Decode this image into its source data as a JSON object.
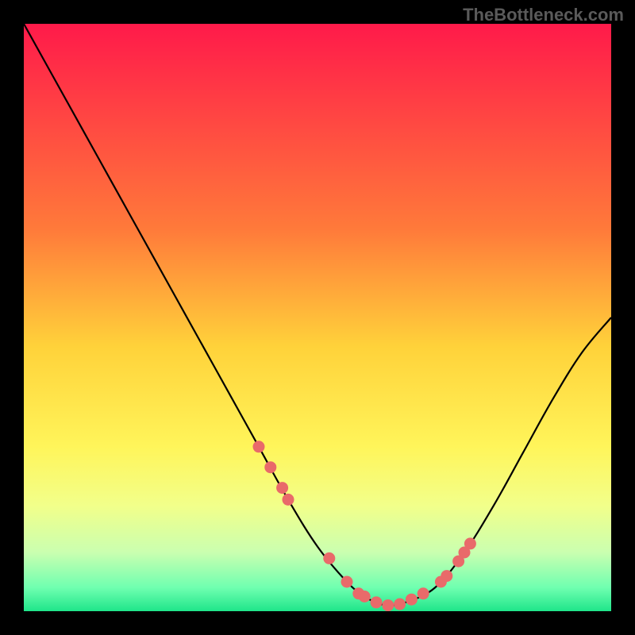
{
  "watermark": "TheBottleneck.com",
  "chart_data": {
    "type": "line",
    "title": "",
    "xlabel": "",
    "ylabel": "",
    "xlim": [
      0,
      100
    ],
    "ylim": [
      0,
      100
    ],
    "gradient_stops": [
      {
        "offset": 0,
        "color": "#ff1a4a"
      },
      {
        "offset": 35,
        "color": "#ff7a3a"
      },
      {
        "offset": 55,
        "color": "#ffd23a"
      },
      {
        "offset": 72,
        "color": "#fff55a"
      },
      {
        "offset": 82,
        "color": "#f2ff8a"
      },
      {
        "offset": 90,
        "color": "#caffb0"
      },
      {
        "offset": 96,
        "color": "#6fffb0"
      },
      {
        "offset": 100,
        "color": "#1fe58a"
      }
    ],
    "series": [
      {
        "name": "bottleneck-curve",
        "x": [
          0,
          5,
          10,
          15,
          20,
          25,
          30,
          35,
          40,
          45,
          50,
          55,
          58,
          60,
          62,
          65,
          70,
          75,
          80,
          85,
          90,
          95,
          100
        ],
        "y": [
          100,
          91,
          82,
          73,
          64,
          55,
          46,
          37,
          28,
          19,
          11,
          5,
          2.5,
          1.5,
          1,
          1.5,
          4,
          10,
          18,
          27,
          36,
          44,
          50
        ]
      }
    ],
    "markers": {
      "name": "highlight-points",
      "color": "#e96a6a",
      "points": [
        {
          "x": 40,
          "y": 28
        },
        {
          "x": 42,
          "y": 24.5
        },
        {
          "x": 44,
          "y": 21
        },
        {
          "x": 45,
          "y": 19
        },
        {
          "x": 52,
          "y": 9
        },
        {
          "x": 55,
          "y": 5
        },
        {
          "x": 57,
          "y": 3
        },
        {
          "x": 58,
          "y": 2.5
        },
        {
          "x": 60,
          "y": 1.5
        },
        {
          "x": 62,
          "y": 1
        },
        {
          "x": 64,
          "y": 1.2
        },
        {
          "x": 66,
          "y": 2
        },
        {
          "x": 68,
          "y": 3
        },
        {
          "x": 71,
          "y": 5
        },
        {
          "x": 72,
          "y": 6
        },
        {
          "x": 74,
          "y": 8.5
        },
        {
          "x": 75,
          "y": 10
        },
        {
          "x": 76,
          "y": 11.5
        }
      ]
    }
  }
}
